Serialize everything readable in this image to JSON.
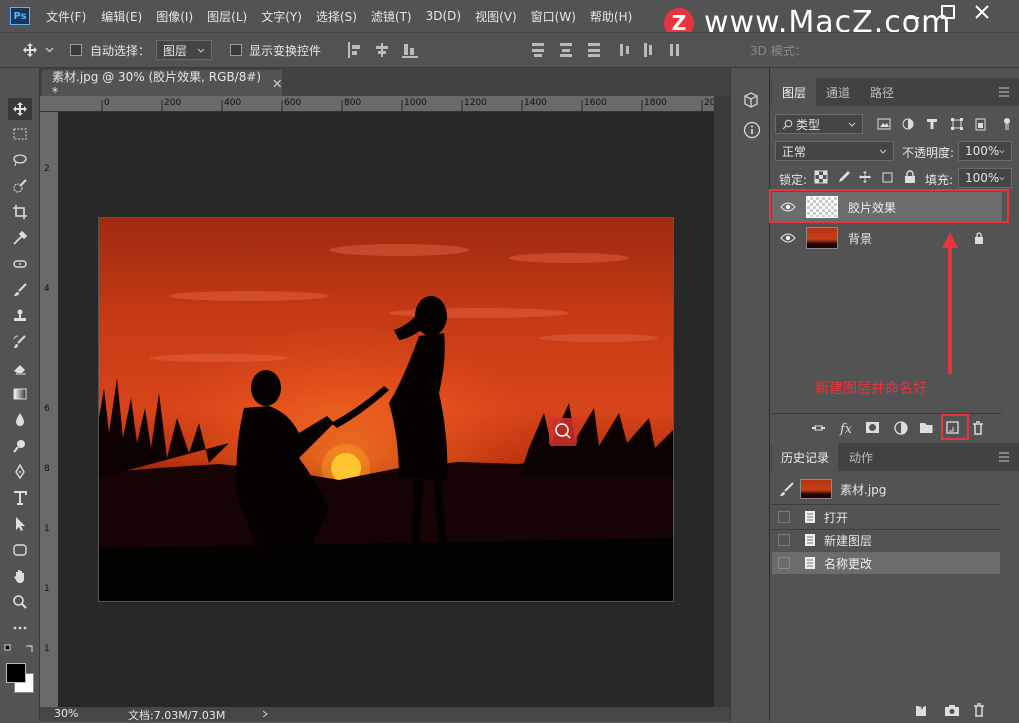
{
  "app": {
    "logo": "Ps"
  },
  "menu": [
    "文件(F)",
    "编辑(E)",
    "图像(I)",
    "图层(L)",
    "文字(Y)",
    "选择(S)",
    "滤镜(T)",
    "3D(D)",
    "视图(V)",
    "窗口(W)",
    "帮助(H)"
  ],
  "watermark": {
    "logo_letter": "Z",
    "text": "www.MacZ.com"
  },
  "options": {
    "auto_select_label": "自动选择：",
    "auto_select_value": "图层",
    "show_transform_label": "显示变换控件",
    "mode_label": "3D 模式："
  },
  "document": {
    "tab_title": "素材.jpg @ 30% (胶片效果, RGB/8#) *",
    "ruler_top": [
      "0",
      "200",
      "400",
      "600",
      "800",
      "1000",
      "1200",
      "1400",
      "1600",
      "1800",
      "20"
    ],
    "ruler_left": [
      "2",
      "4",
      "6",
      "8",
      "1",
      "1",
      "1"
    ],
    "zoom": "30%",
    "doc_info": "文档:7.03M/7.03M"
  },
  "layers_panel": {
    "tabs": [
      "图层",
      "通道",
      "路径"
    ],
    "filter_type": "类型",
    "blend_mode": "正常",
    "opacity_label": "不透明度:",
    "opacity_value": "100%",
    "lock_label": "锁定:",
    "fill_label": "填充:",
    "fill_value": "100%",
    "layers": [
      {
        "name": "胶片效果",
        "visible": true,
        "selected": true,
        "locked": false
      },
      {
        "name": "背景",
        "visible": true,
        "selected": false,
        "locked": true
      }
    ],
    "annotation": "新建图层并命名好"
  },
  "history_panel": {
    "tabs": [
      "历史记录",
      "动作"
    ],
    "snapshot": "素材.jpg",
    "states": [
      {
        "name": "打开",
        "selected": false
      },
      {
        "name": "新建图层",
        "selected": false
      },
      {
        "name": "名称更改",
        "selected": true
      }
    ]
  },
  "colors": {
    "annotation_red": "#e8343d",
    "panel_bg": "#535353",
    "canvas_bg": "#282828",
    "selected_row": "#6c6c6c"
  }
}
